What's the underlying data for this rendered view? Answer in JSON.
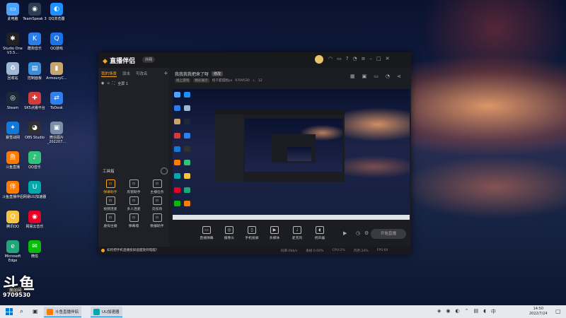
{
  "desktop": {
    "icons": [
      {
        "label": "此电脑",
        "icon": "computer-icon",
        "color": "#4aa3ff",
        "glyph": "▭"
      },
      {
        "label": "TeamSpeak 3",
        "icon": "teamspeak-icon",
        "color": "#2c3e50",
        "glyph": "◉"
      },
      {
        "label": "QQ浏览器",
        "icon": "qq-browser-icon",
        "color": "#1e90ff",
        "glyph": "◐"
      },
      {
        "label": "Studio One V3.5...",
        "icon": "studio-one-icon",
        "color": "#222222",
        "glyph": "✱"
      },
      {
        "label": "酷狗音乐",
        "icon": "kugou-icon",
        "color": "#2b7de9",
        "glyph": "K"
      },
      {
        "label": "QQ游戏",
        "icon": "qq-game-icon",
        "color": "#1a74e8",
        "glyph": "Q"
      },
      {
        "label": "回收站",
        "icon": "recycle-bin-icon",
        "color": "#9fb8d4",
        "glyph": "♻"
      },
      {
        "label": "控制面板",
        "icon": "control-panel-icon",
        "color": "#3a8fd8",
        "glyph": "▤"
      },
      {
        "label": "ArmouryC...",
        "icon": "armoury-icon",
        "color": "#c8a46e",
        "glyph": "▮"
      },
      {
        "label": "Steam",
        "icon": "steam-icon",
        "color": "#1b2838",
        "glyph": "◎"
      },
      {
        "label": "SK5点播平台",
        "icon": "sk5-icon",
        "color": "#d33c3c",
        "glyph": "✚"
      },
      {
        "label": "ToDesk",
        "icon": "todesk-icon",
        "color": "#2f7fee",
        "glyph": "⇄"
      },
      {
        "label": "暴雪战网",
        "icon": "battlenet-icon",
        "color": "#1479d6",
        "glyph": "✦"
      },
      {
        "label": "OBS Studio",
        "icon": "obs-icon",
        "color": "#303030",
        "glyph": "◕"
      },
      {
        "label": "微信图片_202207...",
        "icon": "image-file-icon",
        "color": "#7b8fa8",
        "glyph": "▣"
      },
      {
        "label": "斗鱼直播",
        "icon": "douyu-icon",
        "color": "#ff7a00",
        "glyph": "鱼"
      },
      {
        "label": "QQ音乐",
        "icon": "qq-music-icon",
        "color": "#31c27c",
        "glyph": "♪"
      },
      {
        "label": "",
        "icon": "blank-icon",
        "color": "transparent",
        "glyph": ""
      },
      {
        "label": "斗鱼直播伴侣",
        "icon": "douyu-companion-icon",
        "color": "#ff7a00",
        "glyph": "伴"
      },
      {
        "label": "网易UU加速器",
        "icon": "uu-accelerator-icon",
        "color": "#0aa",
        "glyph": "U"
      },
      {
        "label": "",
        "icon": "blank-icon",
        "color": "transparent",
        "glyph": ""
      },
      {
        "label": "腾讯QQ",
        "icon": "tencent-qq-icon",
        "color": "#f6c343",
        "glyph": "Q"
      },
      {
        "label": "网易云音乐",
        "icon": "netease-music-icon",
        "color": "#e60026",
        "glyph": "◉"
      },
      {
        "label": "",
        "icon": "blank-icon",
        "color": "transparent",
        "glyph": ""
      },
      {
        "label": "Microsoft Edge",
        "icon": "edge-icon",
        "color": "#1fa67a",
        "glyph": "e"
      },
      {
        "label": "微信",
        "icon": "wechat-icon",
        "color": "#09bb07",
        "glyph": "✉"
      }
    ]
  },
  "watermark": {
    "logo": "斗鱼",
    "badge": "房间号",
    "number": "9709530"
  },
  "app": {
    "logo_main": "直播伴侣",
    "logo_prefix": "",
    "version": "外网",
    "sidebar": {
      "tabs": [
        "我的场景",
        "双击",
        "可改名"
      ],
      "scene_label": "全屏 1",
      "tools_title": "工具箱",
      "tools": [
        {
          "label": "弹幕助手",
          "icon": "danmaku-assistant-icon",
          "accent": true
        },
        {
          "label": "房管助手",
          "icon": "moderator-icon",
          "accent": false
        },
        {
          "label": "主播任务",
          "icon": "task-icon",
          "accent": false
        },
        {
          "label": "视频连麦",
          "icon": "video-link-icon",
          "accent": false
        },
        {
          "label": "多人连麦",
          "icon": "multi-link-icon",
          "accent": false
        },
        {
          "label": "竞技场",
          "icon": "arena-icon",
          "accent": false
        },
        {
          "label": "虚拟主播",
          "icon": "virtual-anchor-icon",
          "accent": false
        },
        {
          "label": "弹幕墙",
          "icon": "danmaku-wall-icon",
          "accent": false
        },
        {
          "label": "数据助手",
          "icon": "data-assistant-icon",
          "accent": false
        }
      ]
    },
    "main": {
      "room_title": "我我我我把来了呀",
      "edit_label": "修改",
      "room_tag": "线上游戏",
      "room_category": "精彩展示",
      "room_owner": "橙子甜甜圈yo",
      "room_id": "9709530",
      "hot_value": "12"
    },
    "bottom_toolbar": [
      {
        "label": "直播弹幕",
        "icon": "live-danmaku-icon"
      },
      {
        "label": "摄像头",
        "icon": "camera-icon"
      },
      {
        "label": "手机投屏",
        "icon": "phone-cast-icon"
      },
      {
        "label": "多媒体",
        "icon": "media-icon"
      },
      {
        "label": "麦克风",
        "icon": "microphone-icon"
      },
      {
        "label": "扬声器",
        "icon": "speaker-icon"
      }
    ],
    "go_live_label": "开始直播",
    "status_tip": "如何把手机直播投屏画面放到电脑？",
    "status_metrics": [
      "码率:0kb/s",
      "丢帧:0.00%",
      "CPU:2%",
      "内存:24%",
      "FPS:60"
    ]
  },
  "taskbar": {
    "apps": [
      {
        "label": "斗鱼直播伴侣",
        "icon": "douyu-companion-icon",
        "color": "#ff7a00"
      },
      {
        "label": "UU加速器",
        "icon": "uu-accelerator-icon",
        "color": "#0aa"
      }
    ],
    "time": "14:50",
    "date": "2022/7/24"
  }
}
